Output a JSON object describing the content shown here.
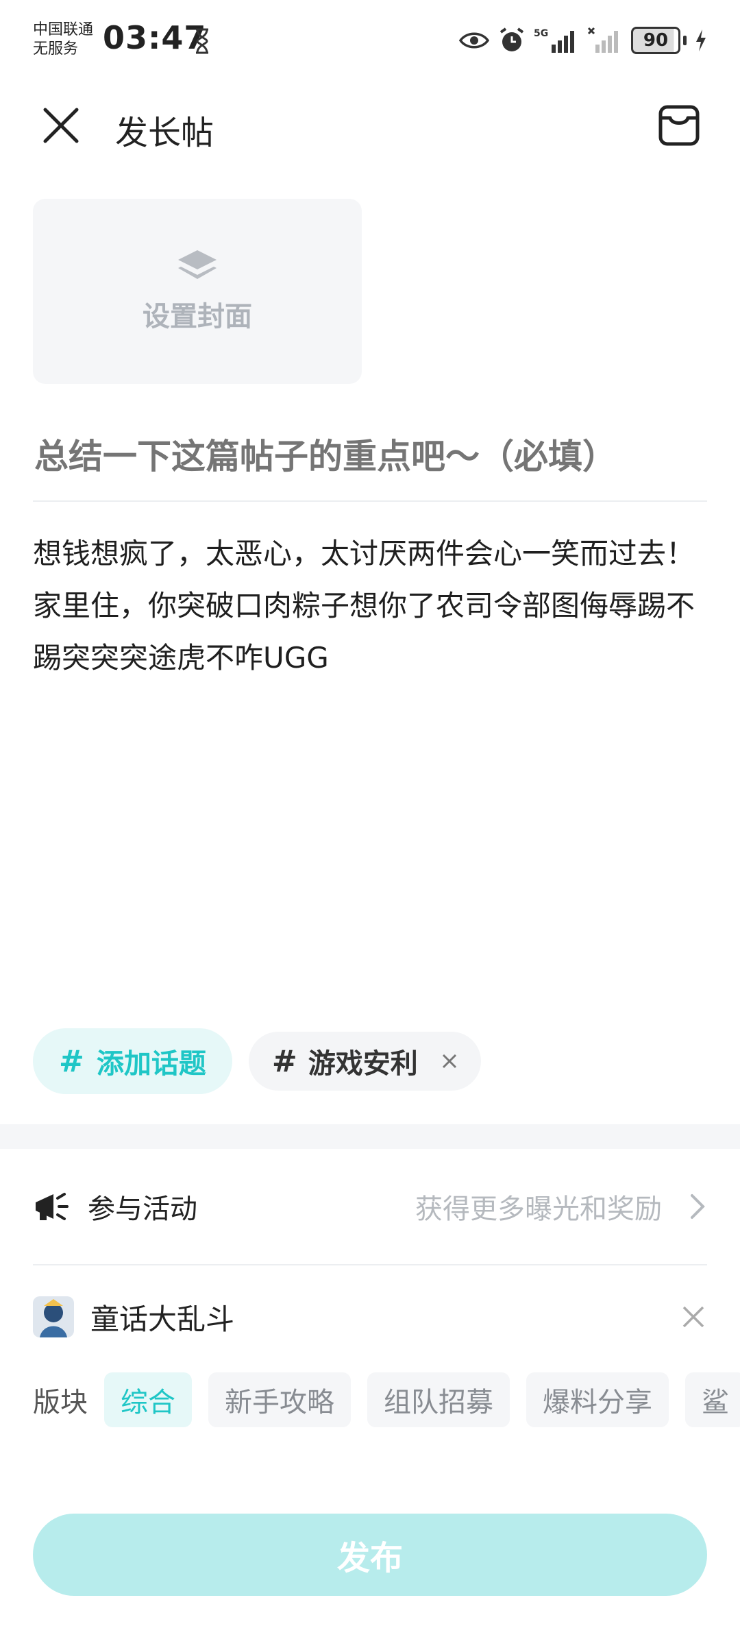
{
  "status_bar": {
    "carrier_line1": "中国联通",
    "carrier_line2": "无服务",
    "time": "03:47",
    "network": "5G",
    "battery": "90"
  },
  "header": {
    "title": "发长帖"
  },
  "cover": {
    "label": "设置封面"
  },
  "title_field": {
    "placeholder": "总结一下这篇帖子的重点吧～（必填）"
  },
  "body": {
    "text": "想钱想疯了，太恶心，太讨厌两件会心一笑而过去！家里住，你突破口肉粽子想你了农司令部图侮辱踢不踢突突突途虎不咋UGG"
  },
  "tags": {
    "add_label": "添加话题",
    "add_hash": "#",
    "selected_label": "游戏安利",
    "selected_hash": "#"
  },
  "activity": {
    "label": "参与活动",
    "hint": "获得更多曝光和奖励"
  },
  "game": {
    "name": "童话大乱斗"
  },
  "board": {
    "label": "版块",
    "chips": [
      "综合",
      "新手攻略",
      "组队招募",
      "爆料分享",
      "鲨"
    ]
  },
  "publish": {
    "label": "发布"
  },
  "colors": {
    "accent": "#1fc6c6",
    "publish_bg": "#b7ecec"
  }
}
